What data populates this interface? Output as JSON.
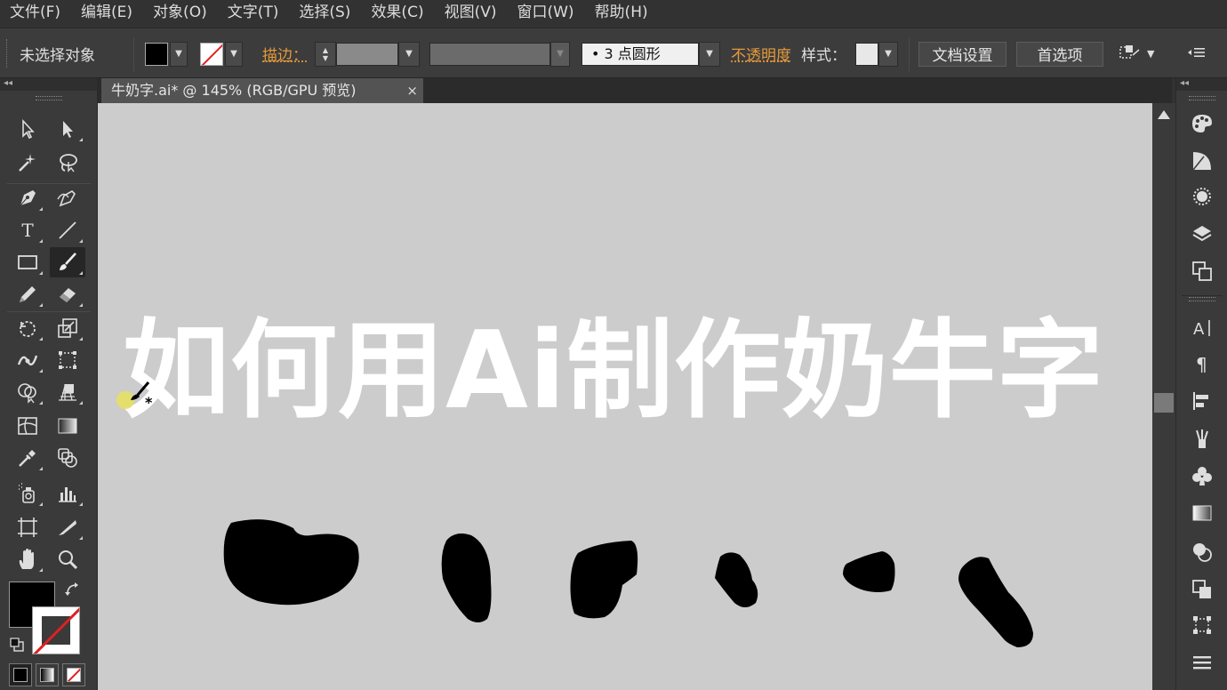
{
  "menu": [
    "文件(F)",
    "编辑(E)",
    "对象(O)",
    "文字(T)",
    "选择(S)",
    "效果(C)",
    "视图(V)",
    "窗口(W)",
    "帮助(H)"
  ],
  "control_bar": {
    "selection_status": "未选择对象",
    "stroke_label": "描边：",
    "brush_size": "•  3  点圆形",
    "opacity_label": "不透明度",
    "style_label": "样式：",
    "doc_settings_button": "文档设置",
    "preferences_button": "首选项"
  },
  "document_tab": {
    "title": "牛奶字.ai* @ 145% (RGB/GPU 预览)",
    "close": "×"
  },
  "canvas": {
    "headline": "如何用Ai制作奶牛字",
    "background_color": "#cccccc",
    "text_color": "#ffffff"
  },
  "colors": {
    "fill": "#000000",
    "stroke": "none",
    "accent_orange": "#e59a3a"
  },
  "tools_left": [
    "selection-tool-icon",
    "direct-selection-tool-icon",
    "magic-wand-icon",
    "lasso-icon",
    "pen-tool-icon",
    "curvature-tool-icon",
    "type-tool-icon",
    "line-tool-icon",
    "rectangle-tool-icon",
    "paintbrush-tool-icon",
    "pencil-tool-icon",
    "eraser-tool-icon",
    "rotate-tool-icon",
    "scale-tool-icon",
    "width-tool-icon",
    "free-transform-icon",
    "shape-builder-icon",
    "perspective-grid-icon",
    "mesh-tool-icon",
    "gradient-tool-icon",
    "eyedropper-icon",
    "blend-tool-icon",
    "symbol-sprayer-icon",
    "column-graph-icon",
    "artboard-tool-icon",
    "slice-tool-icon",
    "hand-tool-icon",
    "zoom-tool-icon"
  ],
  "tools_right": [
    "color-panel-icon",
    "color-guide-icon",
    "appearance-icon",
    "layers-icon",
    "artboards-icon",
    "character-icon",
    "paragraph-icon",
    "align-icon",
    "brushes-icon",
    "symbols-icon",
    "gradient-panel-icon",
    "transparency-icon",
    "pathfinder-icon",
    "transform-icon",
    "properties-menu-icon"
  ]
}
